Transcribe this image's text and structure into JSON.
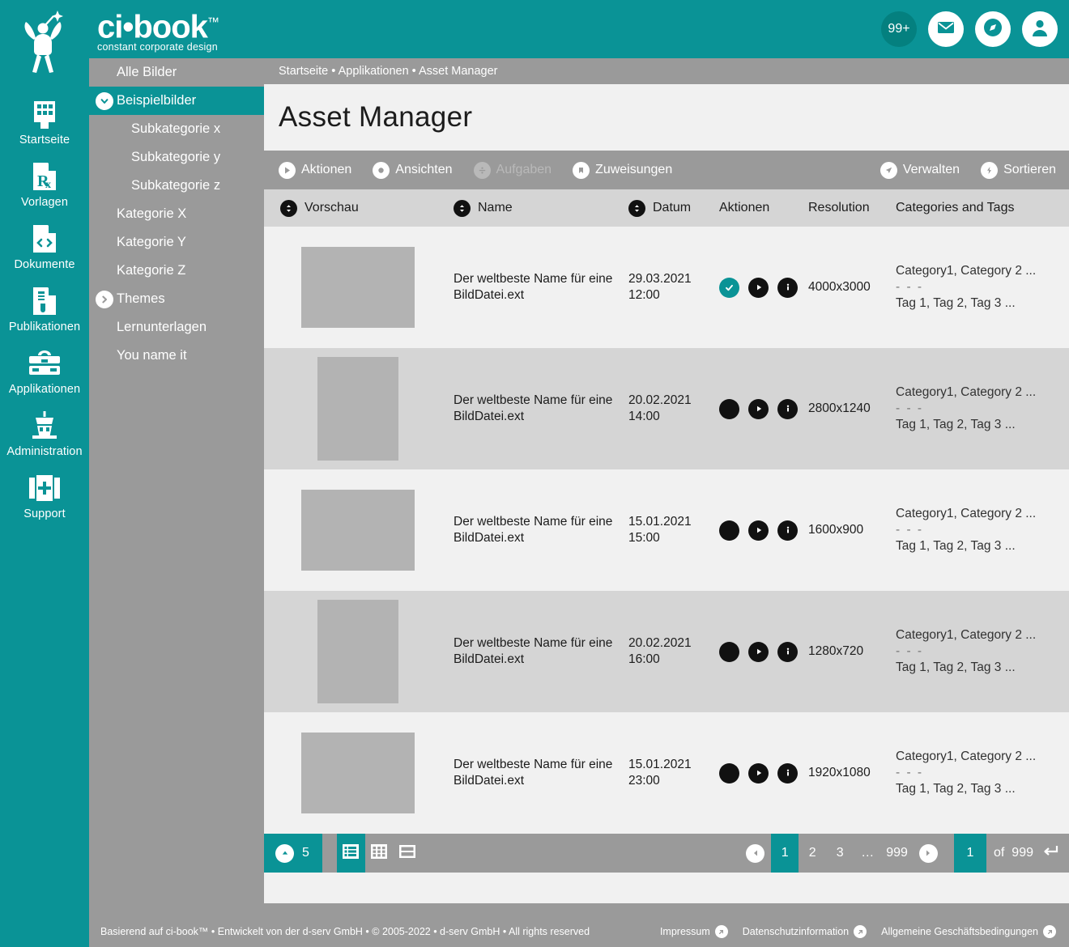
{
  "brand": {
    "name": "ci•book",
    "tm": "™",
    "tagline": "constant corporate design",
    "teal": "#0a9396",
    "logo_icon": "fairy-logo-icon"
  },
  "header": {
    "notification_count": "99+",
    "mail_icon": "envelope-icon",
    "compass_icon": "compass-icon",
    "account_icon": "user-account-icon"
  },
  "rail": {
    "items": [
      {
        "label": "Startseite",
        "icon": "building-icon"
      },
      {
        "label": "Vorlagen",
        "icon": "prescription-document-icon"
      },
      {
        "label": "Dokumente",
        "icon": "code-document-icon"
      },
      {
        "label": "Publikationen",
        "icon": "publication-document-icon"
      },
      {
        "label": "Applikationen",
        "icon": "toolbox-icon"
      },
      {
        "label": "Administration",
        "icon": "control-tower-icon"
      },
      {
        "label": "Support",
        "icon": "first-aid-kit-icon"
      }
    ]
  },
  "categories": {
    "items": [
      {
        "label": "Alle Bilder",
        "level": 0,
        "state": "none",
        "active": false
      },
      {
        "label": "Beispielbilder",
        "level": 0,
        "state": "expanded",
        "active": true
      },
      {
        "label": "Subkategorie x",
        "level": 1,
        "state": "none",
        "active": false
      },
      {
        "label": "Subkategorie y",
        "level": 1,
        "state": "none",
        "active": false
      },
      {
        "label": "Subkategorie z",
        "level": 1,
        "state": "none",
        "active": false
      },
      {
        "label": "Kategorie X",
        "level": 0,
        "state": "none",
        "active": false
      },
      {
        "label": "Kategorie Y",
        "level": 0,
        "state": "none",
        "active": false
      },
      {
        "label": "Kategorie Z",
        "level": 0,
        "state": "none",
        "active": false
      },
      {
        "label": "Themes",
        "level": 0,
        "state": "collapsed",
        "active": false
      },
      {
        "label": "Lernunterlagen",
        "level": 0,
        "state": "none",
        "active": false
      },
      {
        "label": "You name it",
        "level": 0,
        "state": "none",
        "active": false
      }
    ]
  },
  "breadcrumb": "Startseite • Applikationen • Asset Manager",
  "page_title": "Asset Manager",
  "toolbar": {
    "left": [
      {
        "label": "Aktionen",
        "icon": "play-circle-icon",
        "disabled": false
      },
      {
        "label": "Ansichten",
        "icon": "record-circle-icon",
        "disabled": false
      },
      {
        "label": "Aufgaben",
        "icon": "divide-circle-icon",
        "disabled": true
      },
      {
        "label": "Zuweisungen",
        "icon": "bookmark-circle-icon",
        "disabled": false
      }
    ],
    "right": [
      {
        "label": "Verwalten",
        "icon": "paper-plane-icon"
      },
      {
        "label": "Sortieren",
        "icon": "lightning-bolt-icon"
      }
    ]
  },
  "table": {
    "columns": [
      {
        "label": "Vorschau",
        "sortable": true,
        "key": "preview"
      },
      {
        "label": "Name",
        "sortable": true,
        "key": "name"
      },
      {
        "label": "Datum",
        "sortable": true,
        "key": "date"
      },
      {
        "label": "Aktionen",
        "sortable": false,
        "key": "actions"
      },
      {
        "label": "Resolution",
        "sortable": false,
        "key": "resolution"
      },
      {
        "label": "Categories and Tags",
        "sortable": false,
        "key": "tags"
      }
    ],
    "rows": [
      {
        "thumb": "landscape",
        "name": "Der weltbeste Name für eine BildDatei.ext",
        "date": "29.03.2021",
        "time": "12:00",
        "selected": true,
        "resolution": "4000x3000",
        "categories": "Category1, Category 2 ...",
        "separator": "- - -",
        "tags": "Tag 1, Tag 2, Tag 3 ..."
      },
      {
        "thumb": "portrait",
        "name": "Der weltbeste Name für eine BildDatei.ext",
        "date": "20.02.2021",
        "time": "14:00",
        "selected": false,
        "resolution": "2800x1240",
        "categories": "Category1, Category 2 ...",
        "separator": "- - -",
        "tags": "Tag 1, Tag 2, Tag 3 ..."
      },
      {
        "thumb": "landscape",
        "name": "Der weltbeste Name für eine BildDatei.ext",
        "date": "15.01.2021",
        "time": "15:00",
        "selected": false,
        "resolution": "1600x900",
        "categories": "Category1, Category 2 ...",
        "separator": "- - -",
        "tags": "Tag 1, Tag 2, Tag 3 ..."
      },
      {
        "thumb": "portrait",
        "name": "Der weltbeste Name für eine BildDatei.ext",
        "date": "20.02.2021",
        "time": "16:00",
        "selected": false,
        "resolution": "1280x720",
        "categories": "Category1, Category 2 ...",
        "separator": "- - -",
        "tags": "Tag 1, Tag 2, Tag 3 ..."
      },
      {
        "thumb": "landscape",
        "name": "Der weltbeste Name für eine BildDatei.ext",
        "date": "15.01.2021",
        "time": "23:00",
        "selected": false,
        "resolution": "1920x1080",
        "categories": "Category1, Category 2 ...",
        "separator": "- - -",
        "tags": "Tag 1, Tag 2, Tag 3 ..."
      }
    ]
  },
  "pagination": {
    "per_page": "5",
    "per_page_icon": "chevron-up-circle-icon",
    "views": [
      {
        "icon": "list-view-icon",
        "active": true
      },
      {
        "icon": "grid-view-icon",
        "active": false
      },
      {
        "icon": "split-view-icon",
        "active": false
      }
    ],
    "prev_icon": "arrow-left-circle-icon",
    "next_icon": "arrow-right-circle-icon",
    "pages": [
      "1",
      "2",
      "3",
      "…",
      "999"
    ],
    "current_page": "1",
    "jump_value": "1",
    "of_label": "of",
    "total_pages": "999",
    "enter_icon": "enter-key-icon"
  },
  "footer": {
    "copy": "Basierend auf ci-book™ • Entwickelt von der d-serv GmbH • © 2005-2022 • d-serv GmbH • All rights reserved",
    "links": [
      {
        "label": "Impressum",
        "icon": "external-link-icon"
      },
      {
        "label": "Datenschutzinformation",
        "icon": "external-link-icon"
      },
      {
        "label": "Allgemeine Geschäftsbedingungen",
        "icon": "external-link-icon"
      }
    ]
  }
}
